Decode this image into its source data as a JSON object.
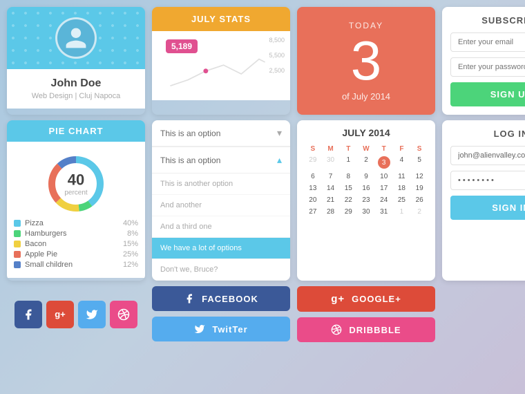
{
  "profile": {
    "name": "John Doe",
    "subtitle": "Web Design | Cluj Napoca"
  },
  "stats": {
    "title": "JULY STATS",
    "value": "5,189",
    "y_labels": [
      "8,500",
      "5,500",
      "2,500"
    ]
  },
  "today": {
    "label": "TODAY",
    "number": "3",
    "subtitle": "of July 2014"
  },
  "subscribe": {
    "title": "SUBSCRIBE",
    "email_placeholder": "Enter your email",
    "password_placeholder": "Enter your password",
    "button_label": "SIGN UP"
  },
  "pie_chart": {
    "title": "PIE CHART",
    "center_number": "40",
    "center_label": "percent",
    "legend": [
      {
        "label": "Pizza",
        "pct": "40%",
        "color": "#5bc8e8"
      },
      {
        "label": "Hamburgers",
        "pct": "8%",
        "color": "#4cd47a"
      },
      {
        "label": "Bacon",
        "pct": "15%",
        "color": "#f0d040"
      },
      {
        "label": "Apple Pie",
        "pct": "25%",
        "color": "#e8705a"
      },
      {
        "label": "Small children",
        "pct": "12%",
        "color": "#5580c8"
      }
    ]
  },
  "dropdown": {
    "selected": "This is an option",
    "options": [
      "This is an option",
      "This is another option",
      "And another",
      "And a third one",
      "We have a lot of options",
      "Don't we, Bruce?"
    ]
  },
  "calendar": {
    "title": "JULY 2014",
    "day_labels": [
      "S",
      "M",
      "T",
      "W",
      "T",
      "F",
      "S"
    ],
    "weeks": [
      [
        "29",
        "30",
        "1",
        "2",
        "3",
        "4",
        "5"
      ],
      [
        "6",
        "7",
        "8",
        "9",
        "10",
        "11",
        "12"
      ],
      [
        "13",
        "14",
        "15",
        "16",
        "17",
        "18",
        "19"
      ],
      [
        "20",
        "21",
        "22",
        "23",
        "24",
        "25",
        "26"
      ],
      [
        "27",
        "28",
        "29",
        "30",
        "31",
        "1",
        "2"
      ]
    ],
    "today_day": "3"
  },
  "login": {
    "title": "LOG IN",
    "email_value": "john@alienvalley.com",
    "password_value": "••••••••",
    "button_label": "SIGN IN"
  },
  "social_icons": {
    "facebook": "f",
    "gplus": "g+",
    "twitter": "t",
    "dribbble": "❋"
  },
  "social_buttons": {
    "facebook": "FACEBOOK",
    "twitter": "TWITTER",
    "google": "GOOGLE+",
    "dribbble": "DRIBBBLE"
  }
}
